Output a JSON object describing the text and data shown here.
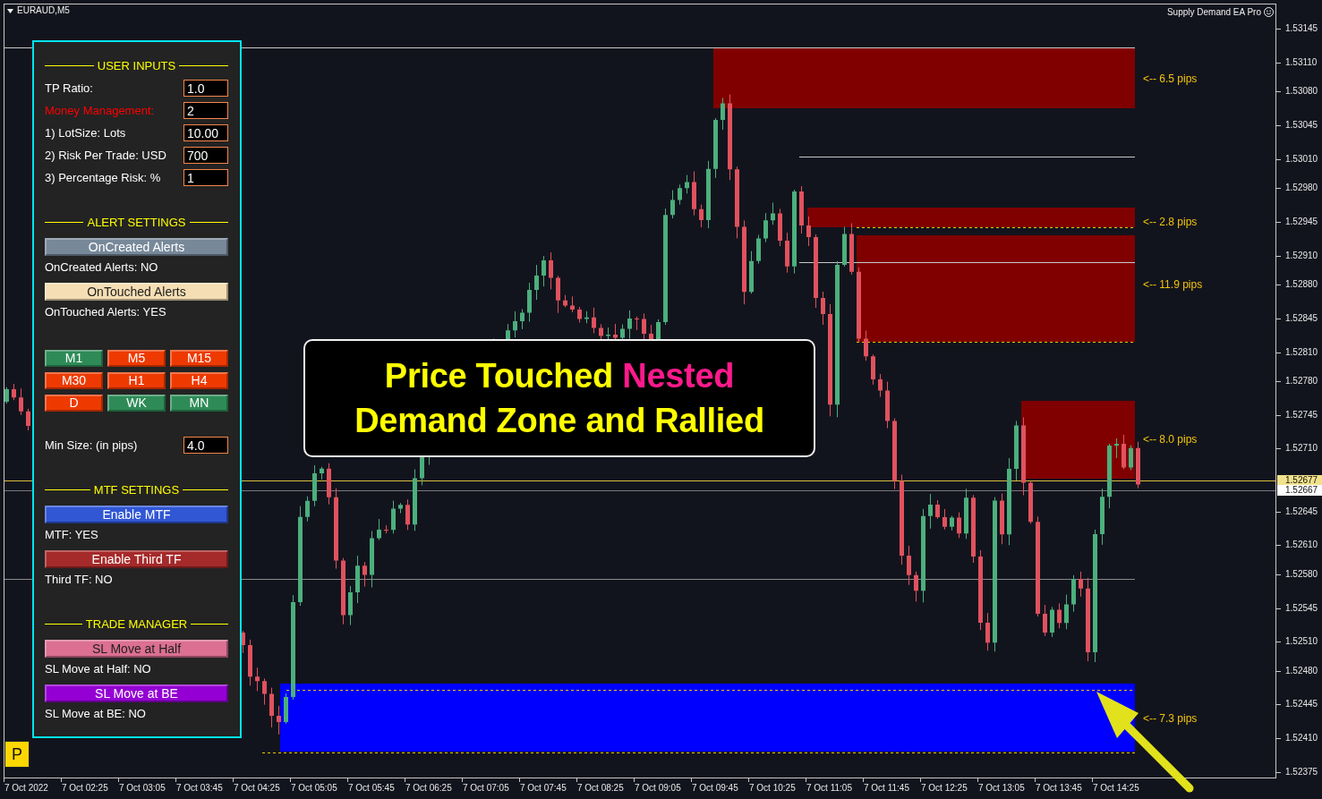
{
  "chart": {
    "symbol": "EURAUD,M5",
    "indicator_title": "Supply Demand EA Pro",
    "zones": [
      {
        "kind": "supply",
        "label": "<-- 6.5 pips"
      },
      {
        "kind": "supply",
        "label": "<-- 2.8 pips"
      },
      {
        "kind": "supply",
        "label": "<-- 11.9 pips"
      },
      {
        "kind": "supply",
        "label": "<-- 8.0 pips"
      },
      {
        "kind": "demand",
        "label": "<-- 7.3 pips"
      }
    ],
    "callout": {
      "lines": [
        [
          {
            "text": "Price Touched ",
            "highlight": false
          },
          {
            "text": "Nested",
            "highlight": true
          }
        ],
        [
          {
            "text": "Demand Zone and Rallied",
            "highlight": false
          }
        ]
      ]
    },
    "price_axis": [
      "1.53145",
      "1.53110",
      "1.53080",
      "1.53045",
      "1.53010",
      "1.52980",
      "1.52945",
      "1.52910",
      "1.52880",
      "1.52845",
      "1.52810",
      "1.52780",
      "1.52745",
      "1.52710",
      "1.52645",
      "1.52610",
      "1.52580",
      "1.52545",
      "1.52510",
      "1.52480",
      "1.52445",
      "1.52410",
      "1.52375"
    ],
    "price_tags": [
      {
        "kind": "level",
        "text": "1.52677"
      },
      {
        "kind": "bid",
        "text": "1.52667"
      }
    ],
    "time_axis": [
      "7 Oct 2022",
      "7 Oct 02:25",
      "7 Oct 03:05",
      "7 Oct 03:45",
      "7 Oct 04:25",
      "7 Oct 05:05",
      "7 Oct 05:45",
      "7 Oct 06:25",
      "7 Oct 07:05",
      "7 Oct 07:45",
      "7 Oct 08:25",
      "7 Oct 09:05",
      "7 Oct 09:45",
      "7 Oct 10:25",
      "7 Oct 11:05",
      "7 Oct 11:45",
      "7 Oct 12:25",
      "7 Oct 13:05",
      "7 Oct 13:45",
      "7 Oct 14:25"
    ]
  },
  "panel": {
    "sections": [
      {
        "kind": "inputs",
        "heading": "USER INPUTS",
        "fields": [
          {
            "label": "TP Ratio:",
            "value": "1.0",
            "color": "#ffffff"
          },
          {
            "label": "Money Management:",
            "value": "2",
            "color": "#ff0000"
          },
          {
            "label": "1) LotSize: Lots",
            "value": "10.00",
            "color": "#ffffff"
          },
          {
            "label": "2) Risk Per Trade: USD",
            "value": "700",
            "color": "#ffffff"
          },
          {
            "label": "3) Percentage Risk: %",
            "value": "1",
            "color": "#ffffff"
          }
        ]
      },
      {
        "kind": "toggles",
        "heading": "ALERT SETTINGS",
        "toggles": [
          {
            "label": "OnCreated Alerts",
            "color": "#778899",
            "status": "OnCreated Alerts: NO"
          },
          {
            "label": "OnTouched Alerts",
            "color": "#f5deb3",
            "status": "OnTouched Alerts: YES"
          }
        ]
      },
      {
        "kind": "timeframes",
        "timeframes": [
          {
            "label": "M1",
            "selected": true
          },
          {
            "label": "M5",
            "selected": false
          },
          {
            "label": "M15",
            "selected": false
          },
          {
            "label": "M30",
            "selected": false
          },
          {
            "label": "H1",
            "selected": false
          },
          {
            "label": "H4",
            "selected": false
          },
          {
            "label": "D",
            "selected": false
          },
          {
            "label": "WK",
            "selected": true
          },
          {
            "label": "MN",
            "selected": true
          }
        ]
      },
      {
        "kind": "inputs",
        "fields": [
          {
            "label": "Min Size: (in pips)",
            "value": "4.0",
            "color": "#ffffff"
          }
        ]
      },
      {
        "kind": "toggles",
        "heading": "MTF SETTINGS",
        "toggles": [
          {
            "label": "Enable MTF",
            "color": "#3157d5",
            "status": "MTF: YES"
          },
          {
            "label": "Enable Third TF",
            "color": "#a52a2a",
            "status": "Third TF: NO"
          }
        ]
      },
      {
        "kind": "toggles",
        "heading": "TRADE MANAGER",
        "toggles": [
          {
            "label": "SL Move at Half",
            "color": "#db7093",
            "status": "SL Move at Half: NO"
          },
          {
            "label": "SL Move at BE",
            "color": "#9400d3",
            "status": "SL Move at BE: NO"
          }
        ]
      }
    ]
  },
  "panel_button": "P"
}
